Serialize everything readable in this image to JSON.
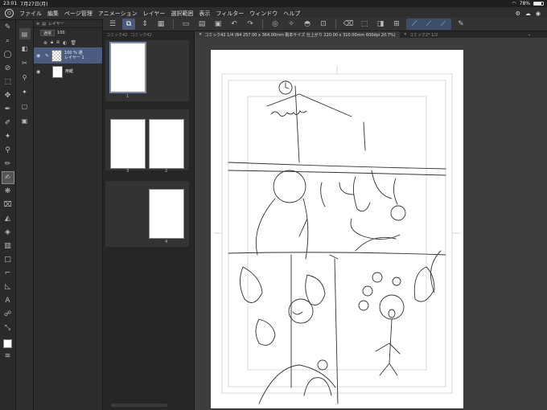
{
  "status": {
    "time": "23:01",
    "date": "7月27日(月)",
    "battery": "78%",
    "battery_level": 0.78
  },
  "menu": {
    "items": [
      "ファイル",
      "編集",
      "ページ管理",
      "アニメーション",
      "レイヤー",
      "選択範囲",
      "表示",
      "フィルター",
      "ウィンドウ",
      "ヘルプ"
    ]
  },
  "layer_panel": {
    "tab_label": "レイヤー",
    "blend_mode": "通常",
    "opacity": "100",
    "layers": [
      {
        "opacity_label": "100 % 通",
        "name": "レイヤー 1"
      },
      {
        "name": "用紙"
      }
    ]
  },
  "page_panel": {
    "tabs": [
      "コミック42",
      "コミック42"
    ],
    "pages": [
      "1",
      "3",
      "2",
      "4"
    ]
  },
  "canvas_tabs": [
    {
      "label": "コミック42 1/4 (B4 257.00 x 364.00mm 製本サイズ 仕上がり 220.00 x 310.00mm 600dpi 20.7%)"
    },
    {
      "label": "コミック2* 1/2"
    }
  ],
  "colors": {
    "accent": "#4b5c80",
    "canvas_bg": "#3d3d3d",
    "paper": "#ffffff"
  }
}
